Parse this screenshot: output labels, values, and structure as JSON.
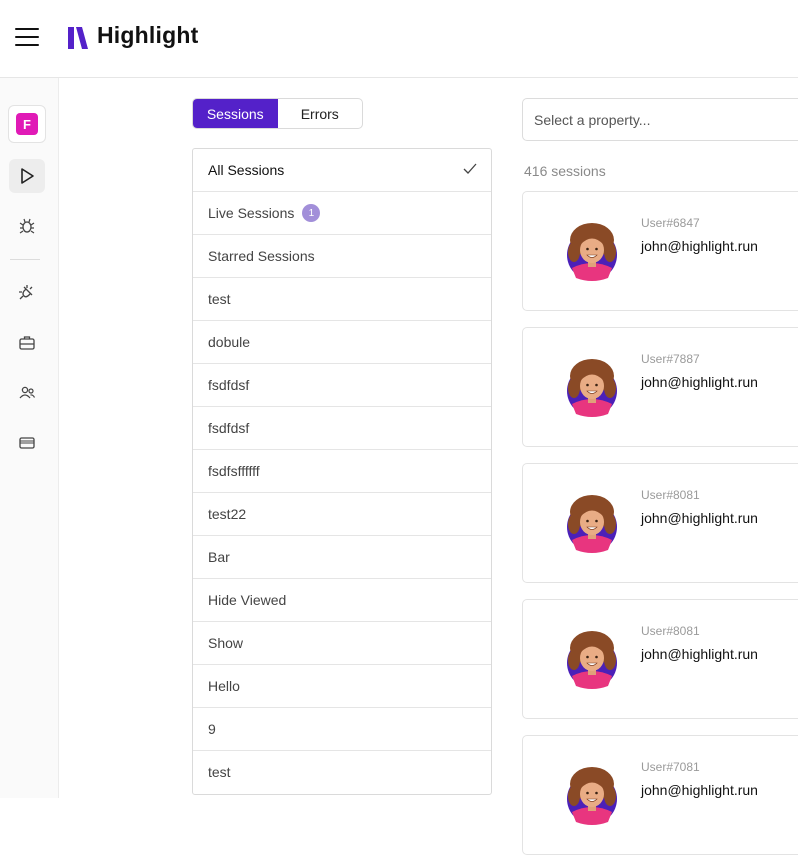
{
  "header": {
    "brand": "Highlight"
  },
  "sidebar": {
    "workspace_initial": "F"
  },
  "tabs": [
    {
      "label": "Sessions"
    },
    {
      "label": "Errors"
    }
  ],
  "segments": [
    {
      "label": "All Sessions"
    },
    {
      "label": "Live Sessions",
      "badge": "1"
    },
    {
      "label": "Starred Sessions"
    },
    {
      "label": "test"
    },
    {
      "label": "dobule"
    },
    {
      "label": "fsdfdsf"
    },
    {
      "label": "fsdfdsf"
    },
    {
      "label": "fsdfsffffff"
    },
    {
      "label": "test22"
    },
    {
      "label": "Bar"
    },
    {
      "label": "Hide Viewed"
    },
    {
      "label": "Show"
    },
    {
      "label": "Hello"
    },
    {
      "label": "9"
    },
    {
      "label": "test"
    }
  ],
  "filter": {
    "placeholder": "Select a property..."
  },
  "session_count": "416 sessions",
  "sessions": [
    {
      "user": "User#6847",
      "email": "john@highlight.run"
    },
    {
      "user": "User#7887",
      "email": "john@highlight.run"
    },
    {
      "user": "User#8081",
      "email": "john@highlight.run"
    },
    {
      "user": "User#8081",
      "email": "john@highlight.run"
    },
    {
      "user": "User#7081",
      "email": "john@highlight.run"
    }
  ],
  "colors": {
    "accent": "#5421c9",
    "workspace": "#e01ab6",
    "badge": "#a28fd9"
  }
}
